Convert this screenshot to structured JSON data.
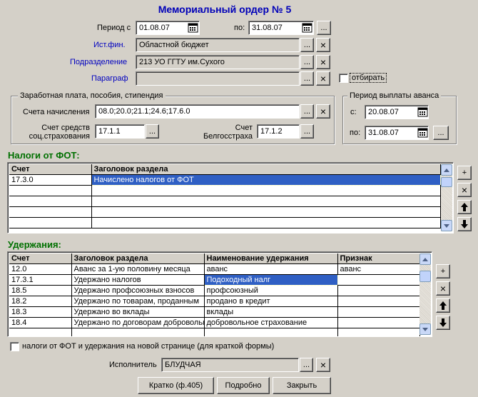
{
  "title": "Мемориальный ордер № 5",
  "period": {
    "from_label": "Период с",
    "from_value": "01.08.07",
    "to_label": "по:",
    "to_value": "31.08.07",
    "more_label": "..."
  },
  "source": {
    "label": "Ист.фин.",
    "value": "Областной бюджет"
  },
  "division": {
    "label": "Подразделение",
    "value": "213 УО ГГТУ им.Сухого"
  },
  "paragraph": {
    "label": "Параграф",
    "value": "",
    "select_label": "отбирать"
  },
  "salary_group": {
    "title": "Заработная плата, пособия, стипендия",
    "accounts_label": "Счета начисления",
    "accounts_value": "08.0;20.0;21.1;24.6;17.6.0",
    "social_label_1": "Счет средств",
    "social_label_2": "соц.страхования",
    "social_value": "17.1.1",
    "belgos_label_1": "Счет",
    "belgos_label_2": "Белгосстраха",
    "belgos_value": "17.1.2"
  },
  "advance_group": {
    "title": "Период выплаты аванса",
    "from_label": "с:",
    "from_value": "20.08.07",
    "to_label": "по:",
    "to_value": "31.08.07"
  },
  "taxes": {
    "section_label": "Налоги от ФОТ:",
    "columns": [
      "Счет",
      "Заголовок раздела"
    ],
    "rows": [
      [
        "17.3.0",
        "Начислено налогов от ФОТ"
      ],
      [
        "",
        ""
      ],
      [
        "",
        ""
      ],
      [
        "",
        ""
      ],
      [
        "",
        ""
      ]
    ]
  },
  "deductions": {
    "section_label": "Удержания:",
    "columns": [
      "Счет",
      "Заголовок раздела",
      "Наименование удержания",
      "Признак"
    ],
    "rows": [
      [
        "12.0",
        "Аванс за 1-ую половину месяца",
        "аванс",
        "аванс"
      ],
      [
        "17.3.1",
        "Удержано налогов",
        "Подоходный налг",
        ""
      ],
      [
        "18.5",
        "Удержано профсоюзных взносов",
        "профсоюзный",
        ""
      ],
      [
        "18.2",
        "Удержано по товарам, проданным",
        "продано в кредит",
        ""
      ],
      [
        "18.3",
        "Удержано во вклады",
        "вклады",
        ""
      ],
      [
        "18.4",
        "Удержано по договорам добровольного",
        "добровольное страхование",
        ""
      ],
      [
        "",
        "",
        "",
        ""
      ]
    ]
  },
  "side_buttons": {
    "add": "+",
    "remove": "×"
  },
  "new_page_checkbox_label": "налоги от ФОТ и удержания на новой странице (для краткой формы)",
  "executor": {
    "label": "Исполнитель",
    "value": "БЛУДЧАЯ"
  },
  "buttons": {
    "short": "Кратко (ф.405)",
    "detailed": "Подробно",
    "close": "Закрыть"
  },
  "ellipsis": "...",
  "clear_symbol": "×"
}
